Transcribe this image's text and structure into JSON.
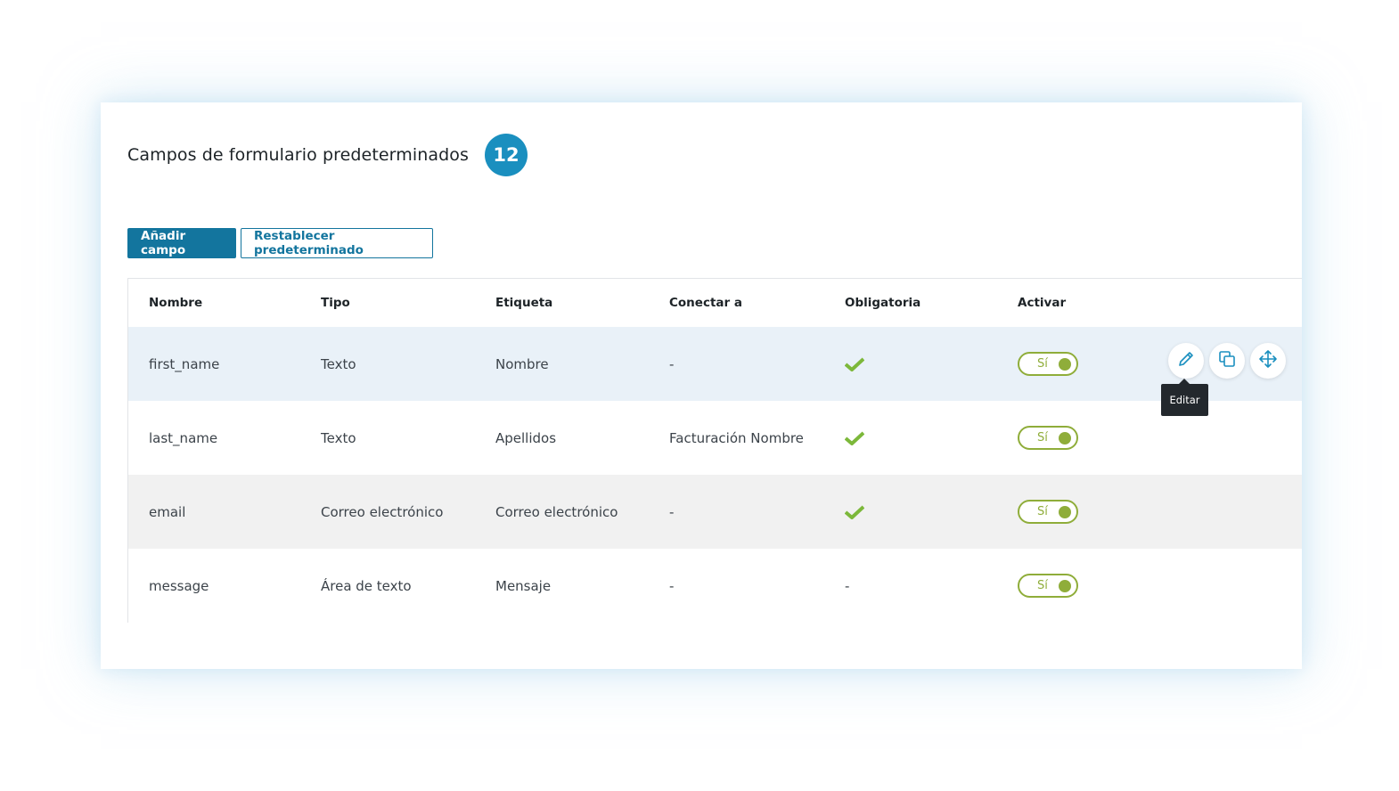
{
  "header": {
    "title": "Campos de formulario predeterminados",
    "badge": "12"
  },
  "toolbar": {
    "add_label": "Añadir campo",
    "reset_label": "Restablecer predeterminado"
  },
  "table": {
    "columns": [
      "Nombre",
      "Tipo",
      "Etiqueta",
      "Conectar a",
      "Obligatoria",
      "Activar"
    ],
    "rows": [
      {
        "name": "first_name",
        "type": "Texto",
        "label": "Nombre",
        "connect": "-",
        "required": true,
        "required_text": "",
        "active": "Sí"
      },
      {
        "name": "last_name",
        "type": "Texto",
        "label": "Apellidos",
        "connect": "Facturación Nombre",
        "required": true,
        "required_text": "",
        "active": "Sí"
      },
      {
        "name": "email",
        "type": "Correo electrónico",
        "label": "Correo electrónico",
        "connect": "-",
        "required": true,
        "required_text": "",
        "active": "Sí"
      },
      {
        "name": "message",
        "type": "Área de texto",
        "label": "Mensaje",
        "connect": "-",
        "required": false,
        "required_text": "-",
        "active": "Sí"
      }
    ]
  },
  "row_actions": {
    "icons": [
      "pencil-icon",
      "duplicate-icon",
      "move-icon"
    ],
    "tooltip": "Editar"
  },
  "colors": {
    "primary": "#13759e",
    "badge": "#1a8fbf",
    "accent_green": "#8fad3a",
    "check_green": "#7cb83a",
    "hover_row": "#e9f1f8"
  }
}
